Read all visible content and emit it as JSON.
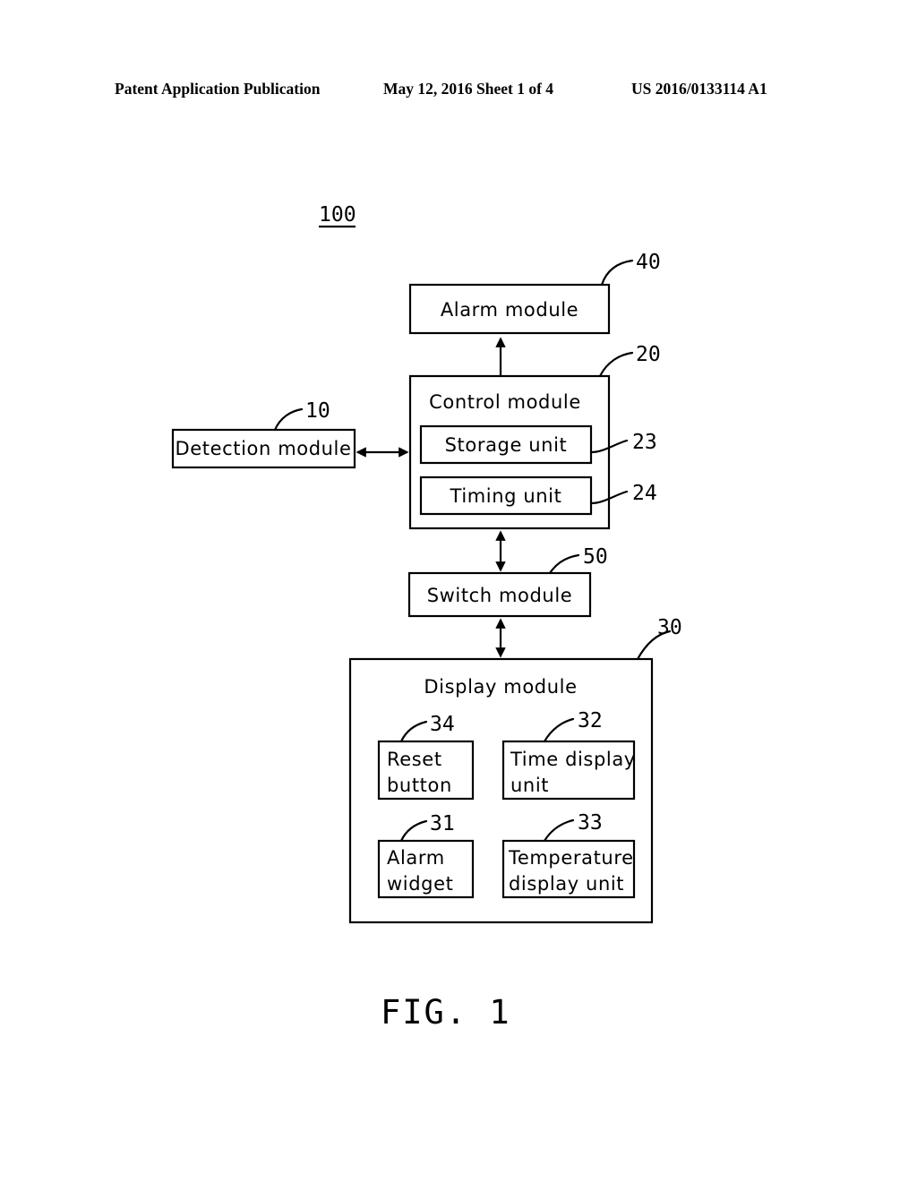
{
  "document": {
    "header": {
      "left": "Patent Application Publication",
      "middle": "May 12, 2016  Sheet 1 of 4",
      "right": "US 2016/0133114 A1"
    },
    "figure_caption": "FIG. 1",
    "system_reference": "100"
  },
  "diagram": {
    "type": "block-diagram",
    "title": "100",
    "blocks": [
      {
        "id": "alarm-module",
        "label": "Alarm  module",
        "ref": "40"
      },
      {
        "id": "control-module",
        "label": "Control  module",
        "ref": "20"
      },
      {
        "id": "storage-unit",
        "label": "Storage  unit",
        "ref": "23"
      },
      {
        "id": "timing-unit",
        "label": "Timing  unit",
        "ref": "24"
      },
      {
        "id": "detection-module",
        "label": "Detection  module",
        "ref": "10"
      },
      {
        "id": "switch-module",
        "label": "Switch  module",
        "ref": "50"
      },
      {
        "id": "display-module",
        "label": "Display  module",
        "ref": "30"
      },
      {
        "id": "reset-button",
        "label_line1": "Reset",
        "label_line2": "button",
        "ref": "34"
      },
      {
        "id": "time-display-unit",
        "label_line1": "Time  display",
        "label_line2": "unit",
        "ref": "32"
      },
      {
        "id": "alarm-widget",
        "label_line1": "Alarm",
        "label_line2": "widget",
        "ref": "31"
      },
      {
        "id": "temperature-display-unit",
        "label_line1": "Temperature",
        "label_line2": "display  unit",
        "ref": "33"
      }
    ],
    "connections": [
      {
        "from": "control-module",
        "to": "alarm-module",
        "arrow": "single-up"
      },
      {
        "from": "detection-module",
        "to": "control-module",
        "arrow": "double-horizontal"
      },
      {
        "from": "control-module",
        "to": "switch-module",
        "arrow": "double-vertical"
      },
      {
        "from": "switch-module",
        "to": "display-module",
        "arrow": "double-vertical"
      }
    ],
    "labels": {
      "alarm_module": "Alarm  module",
      "control_module": "Control  module",
      "storage_unit": "Storage  unit",
      "timing_unit": "Timing  unit",
      "detection_module": "Detection  module",
      "switch_module": "Switch  module",
      "display_module": "Display  module",
      "reset_button_l1": "Reset",
      "reset_button_l2": "button",
      "time_display_l1": "Time  display",
      "time_display_l2": "unit",
      "alarm_widget_l1": "Alarm",
      "alarm_widget_l2": "widget",
      "temperature_l1": "Temperature",
      "temperature_l2": "display  unit"
    },
    "refs": {
      "system": "100",
      "alarm_module": "40",
      "control_module": "20",
      "storage_unit": "23",
      "timing_unit": "24",
      "detection_module": "10",
      "switch_module": "50",
      "display_module": "30",
      "reset_button": "34",
      "time_display_unit": "32",
      "alarm_widget": "31",
      "temperature_display_unit": "33"
    },
    "colors": {
      "ink": "#000000",
      "paper": "#ffffff"
    }
  }
}
